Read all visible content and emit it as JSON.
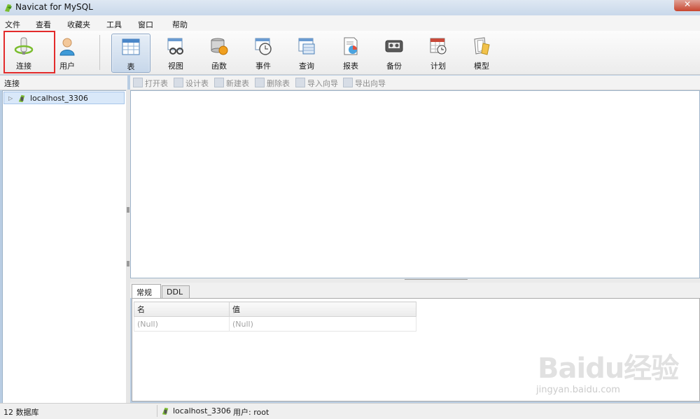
{
  "window": {
    "title": "Navicat for MySQL",
    "close_glyph": "✕"
  },
  "menu": [
    {
      "id": "file",
      "label": "文件"
    },
    {
      "id": "view",
      "label": "查看"
    },
    {
      "id": "favorites",
      "label": "收藏夹"
    },
    {
      "id": "tools",
      "label": "工具"
    },
    {
      "id": "window",
      "label": "窗口"
    },
    {
      "id": "help",
      "label": "帮助"
    }
  ],
  "toolbar": {
    "connect": "连接",
    "user": "用户",
    "table": "表",
    "view": "视图",
    "function": "函数",
    "event": "事件",
    "query": "查询",
    "report": "报表",
    "backup": "备份",
    "schedule": "计划",
    "model": "模型",
    "active": "table"
  },
  "connections_panel": {
    "header": "连接",
    "items": [
      {
        "label": "localhost_3306",
        "icon": "connection-plug-icon"
      }
    ]
  },
  "object_toolbar": {
    "open": "打开表",
    "design": "设计表",
    "new": "新建表",
    "delete": "删除表",
    "import": "导入向导",
    "export": "导出向导"
  },
  "info_tabs": {
    "general": "常规",
    "ddl": "DDL",
    "active": "general"
  },
  "properties": {
    "columns": [
      "名",
      "值"
    ],
    "rows": [
      [
        "(Null)",
        "(Null)"
      ]
    ]
  },
  "statusbar": {
    "db_count": "12 数据库",
    "connection": "localhost_3306",
    "user": "用户: root"
  },
  "watermark": {
    "logo": "Baidu经验",
    "url": "jingyan.baidu.com"
  },
  "colors": {
    "highlight_box": "#e32b2b",
    "selection": "#d9e8f9",
    "disabled_text": "#8c8c8c"
  }
}
